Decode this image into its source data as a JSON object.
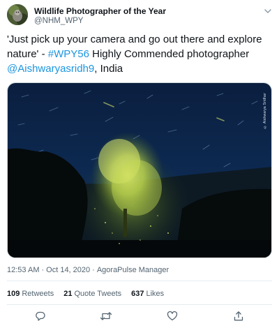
{
  "author": {
    "name": "Wildlife Photographer of the Year",
    "handle": "@NHM_WPY"
  },
  "tweet": {
    "text_part1": "'Just pick up your camera and go out there and explore nature' - ",
    "hashtag": "#WPY56",
    "text_part2": " Highly Commended photographer ",
    "mention": "@Aishwaryasridh9",
    "text_part3": ", India"
  },
  "photo": {
    "credit": "© Aishwarya Sridhar"
  },
  "meta": {
    "time": "12:53 AM",
    "separator": "·",
    "date": "Oct 14, 2020",
    "source": "AgoraPulse Manager"
  },
  "stats": {
    "retweets_count": "109",
    "retweets_label": "Retweets",
    "quotes_count": "21",
    "quotes_label": "Quote Tweets",
    "likes_count": "637",
    "likes_label": "Likes"
  },
  "icons": {
    "reply": "reply-icon",
    "retweet": "retweet-icon",
    "like": "heart-icon",
    "share": "share-icon",
    "more": "chevron-down-icon"
  },
  "colors": {
    "link": "#1b95e0",
    "secondary_text": "#536471",
    "icon": "#536471"
  }
}
